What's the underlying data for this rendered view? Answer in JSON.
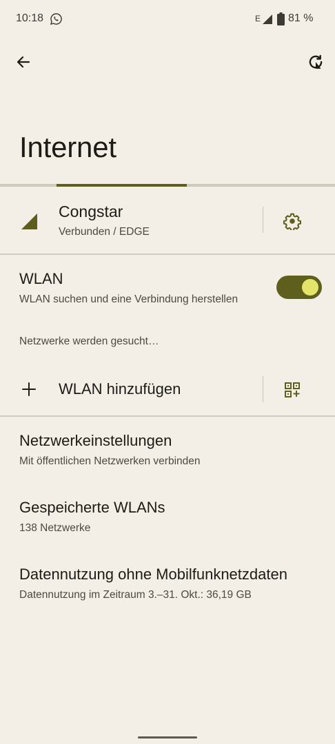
{
  "status_bar": {
    "time": "10:18",
    "network_type": "E",
    "battery": "81 %"
  },
  "header": {
    "title": "Internet",
    "progress_fraction": 0.39
  },
  "carrier": {
    "name": "Congstar",
    "status": "Verbunden / EDGE"
  },
  "wlan": {
    "title": "WLAN",
    "subtitle": "WLAN suchen und eine Verbindung herstellen",
    "enabled": true,
    "scan_status": "Netzwerke werden gesucht…",
    "add_label": "WLAN hinzufügen"
  },
  "preferences": [
    {
      "title": "Netzwerkeinstellungen",
      "summary": "Mit öffentlichen Netzwerken verbinden"
    },
    {
      "title": "Gespeicherte WLANs",
      "summary": "138 Netzwerke"
    },
    {
      "title": "Datennutzung ohne Mobilfunknetzdaten",
      "summary": "Datennutzung im Zeitraum 3.–31. Okt.: 36,19 GB"
    }
  ],
  "colors": {
    "background": "#f3efe7",
    "accent": "#5f5f1d",
    "switch_thumb": "#e5e46a"
  }
}
